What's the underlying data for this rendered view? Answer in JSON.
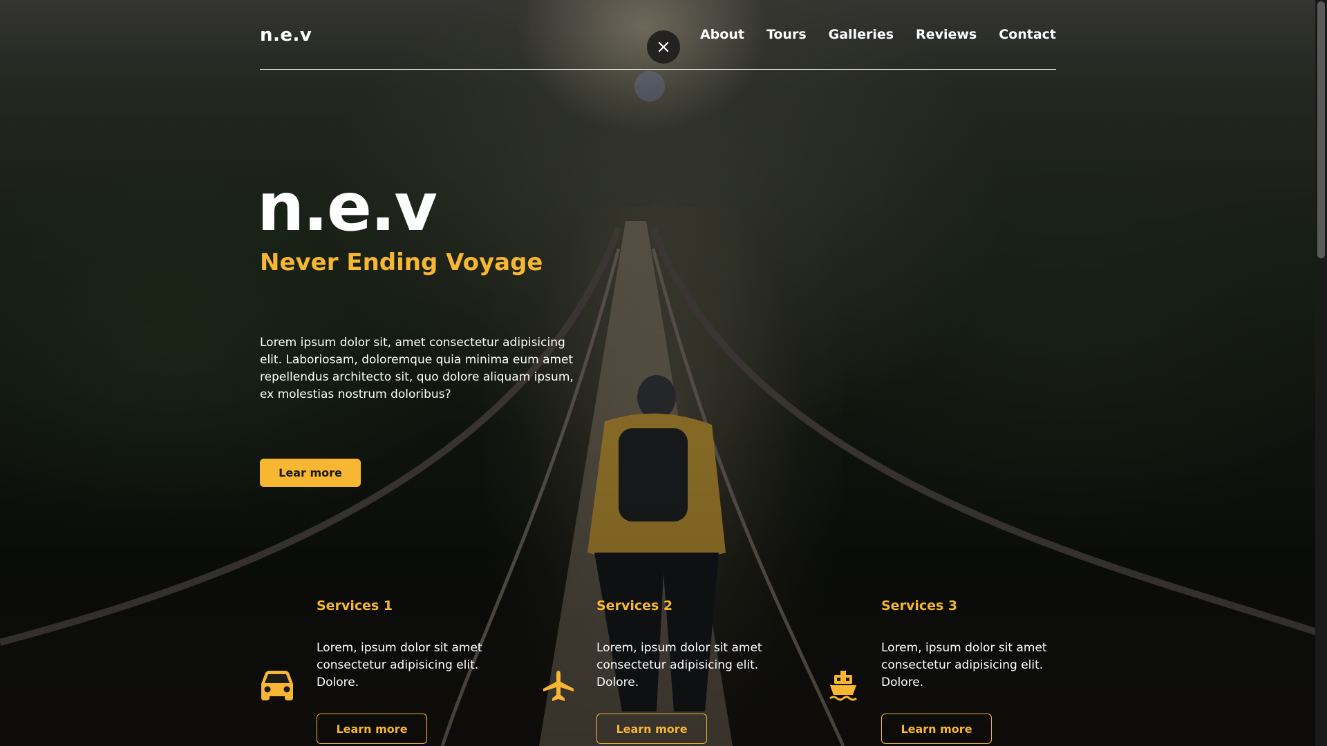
{
  "header": {
    "logo": "n.e.v",
    "nav": [
      "About",
      "Tours",
      "Galleries",
      "Reviews",
      "Contact"
    ]
  },
  "hero": {
    "title": "n.e.v",
    "subtitle": "Never Ending Voyage",
    "text": "Lorem ipsum dolor sit, amet consectetur adipisicing elit. Laboriosam, doloremque quia minima eum amet repellendus architecto sit, quo dolore aliquam ipsum, ex molestias nostrum doloribus?",
    "button": "Lear more"
  },
  "services": [
    {
      "title": "Services 1",
      "text": "Lorem, ipsum dolor sit amet consectetur adipisicing elit. Dolore.",
      "button": "Learn more",
      "icon": "car-icon"
    },
    {
      "title": "Services 2",
      "text": "Lorem, ipsum dolor sit amet consectetur adipisicing elit. Dolore.",
      "button": "Learn more",
      "icon": "airplane-icon"
    },
    {
      "title": "Services 3",
      "text": "Lorem, ipsum dolor sit amet consectetur adipisicing elit. Dolore.",
      "button": "Learn more",
      "icon": "ship-icon"
    }
  ],
  "colors": {
    "accent": "#f7b733",
    "text": "#ffffff"
  }
}
